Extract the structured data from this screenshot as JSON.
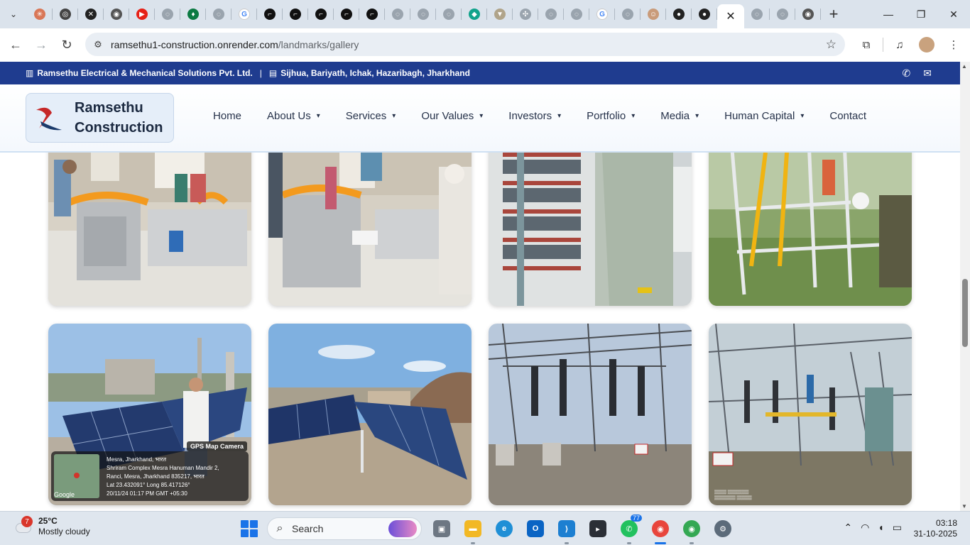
{
  "browser": {
    "url_host": "ramsethu1-construction.onrender.com",
    "url_path": "/landmarks/gallery",
    "tabs": [
      {
        "icon": "claude-icon",
        "color": "#d97757",
        "glyph": "✳"
      },
      {
        "icon": "openai-icon",
        "color": "#444444",
        "glyph": "◎"
      },
      {
        "icon": "x-icon",
        "color": "#222222",
        "glyph": "✕"
      },
      {
        "icon": "chrome-icon",
        "color": "#555555",
        "glyph": "◉"
      },
      {
        "icon": "youtube-icon",
        "color": "#e62117",
        "glyph": "▶"
      },
      {
        "icon": "globe-icon",
        "color": "#9aa4ae",
        "glyph": "◌"
      },
      {
        "icon": "leaf-icon",
        "color": "#0c7a43",
        "glyph": "♦"
      },
      {
        "icon": "globe-icon",
        "color": "#9aa4ae",
        "glyph": "◌"
      },
      {
        "icon": "google-icon",
        "color": "#ffffff",
        "glyph": "G"
      },
      {
        "icon": "render-icon",
        "color": "#111111",
        "glyph": "⌐"
      },
      {
        "icon": "render-icon",
        "color": "#111111",
        "glyph": "⌐"
      },
      {
        "icon": "render-icon",
        "color": "#111111",
        "glyph": "⌐"
      },
      {
        "icon": "render-icon",
        "color": "#111111",
        "glyph": "⌐"
      },
      {
        "icon": "render-icon",
        "color": "#111111",
        "glyph": "⌐"
      },
      {
        "icon": "globe-icon",
        "color": "#9aa4ae",
        "glyph": "◌"
      },
      {
        "icon": "globe-icon",
        "color": "#9aa4ae",
        "glyph": "◌"
      },
      {
        "icon": "globe-icon",
        "color": "#9aa4ae",
        "glyph": "◌"
      },
      {
        "icon": "diamond-icon",
        "color": "#12a38c",
        "glyph": "◆"
      },
      {
        "icon": "vercel-icon",
        "color": "#b0a48a",
        "glyph": "▼"
      },
      {
        "icon": "sparkle-icon",
        "color": "#9aa4ae",
        "glyph": "✣"
      },
      {
        "icon": "globe-icon",
        "color": "#9aa4ae",
        "glyph": "◌"
      },
      {
        "icon": "globe-icon",
        "color": "#9aa4ae",
        "glyph": "◌"
      },
      {
        "icon": "google-icon",
        "color": "#ffffff",
        "glyph": "G"
      },
      {
        "icon": "globe-icon",
        "color": "#9aa4ae",
        "glyph": "◌"
      },
      {
        "icon": "avatar-icon",
        "color": "#c99b7a",
        "glyph": "☺"
      },
      {
        "icon": "github-icon",
        "color": "#222222",
        "glyph": "●"
      },
      {
        "icon": "github-icon",
        "color": "#222222",
        "glyph": "●"
      }
    ],
    "tabs_after_active": [
      {
        "icon": "globe-icon",
        "color": "#9aa4ae",
        "glyph": "◌"
      },
      {
        "icon": "globe-icon",
        "color": "#9aa4ae",
        "glyph": "◌"
      },
      {
        "icon": "chrome-icon",
        "color": "#555555",
        "glyph": "◉"
      }
    ]
  },
  "site": {
    "company": "Ramsethu Electrical & Mechanical Solutions Pvt. Ltd.",
    "address": "Sijhua, Bariyath, Ichak, Hazaribagh, Jharkhand",
    "logo_line1": "Ramsethu",
    "logo_line2": "Construction",
    "nav": [
      {
        "label": "Home",
        "dropdown": false
      },
      {
        "label": "About Us",
        "dropdown": true
      },
      {
        "label": "Services",
        "dropdown": true
      },
      {
        "label": "Our Values",
        "dropdown": true
      },
      {
        "label": "Investors",
        "dropdown": true
      },
      {
        "label": "Portfolio",
        "dropdown": true
      },
      {
        "label": "Media",
        "dropdown": true
      },
      {
        "label": "Human Capital",
        "dropdown": true
      },
      {
        "label": "Contact",
        "dropdown": false
      }
    ]
  },
  "gallery": {
    "photos": [
      {
        "scene": "lab-inauguration"
      },
      {
        "scene": "lab-inauguration-2"
      },
      {
        "scene": "control-panel-wiring"
      },
      {
        "scene": "scaffold-work"
      },
      {
        "scene": "rooftop-solar-person"
      },
      {
        "scene": "rooftop-solar"
      },
      {
        "scene": "substation"
      },
      {
        "scene": "substation-worker"
      }
    ],
    "geo_overlay": {
      "badge": "GPS Map Camera",
      "line1": "Mesra, Jharkhand, भारत",
      "line2": "Shriram Complex Mesra Hanuman Mandir 2,",
      "line3": "Ranci, Mesra, Jharkhand 835217, भारत",
      "line4": "Lat 23.432091° Long 85.417126°",
      "line5": "20/11/24 01:17 PM GMT +05:30",
      "google": "Google"
    }
  },
  "taskbar": {
    "temperature": "25°C",
    "weather": "Mostly cloudy",
    "weather_badge": "7",
    "search_label": "Search",
    "whatsapp_badge": "77",
    "time": "03:18",
    "date": "31-10-2025"
  }
}
